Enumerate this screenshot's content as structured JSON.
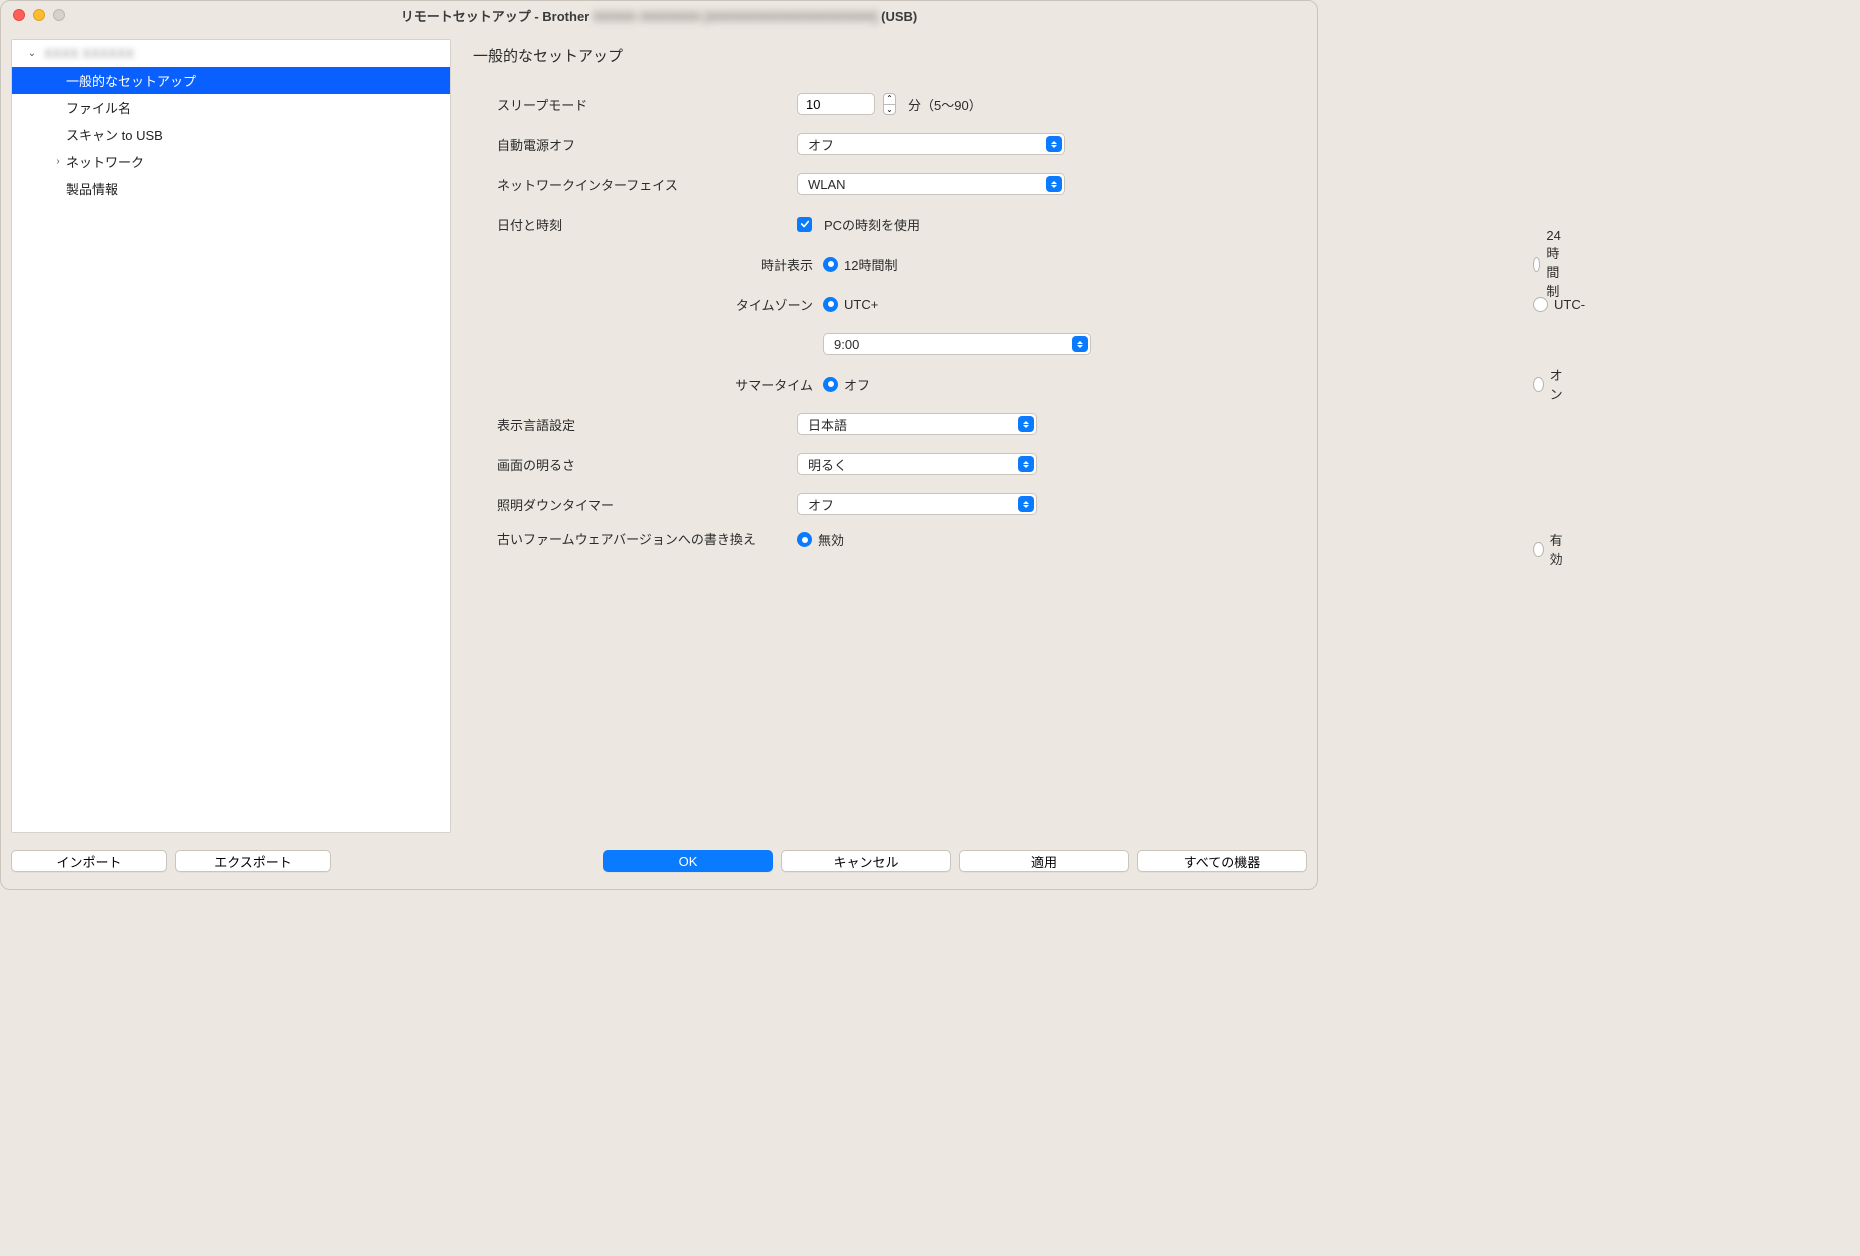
{
  "window": {
    "title_prefix": "リモートセットアップ - Brother ",
    "title_redacted": "XXXXX XXXXXXX [XXXXXXXXXXXXXXXXXXX]",
    "title_suffix": "  (USB)"
  },
  "sidebar": {
    "root_redacted": "XXXX XXXXXX",
    "items": {
      "general": "一般的なセットアップ",
      "filename": "ファイル名",
      "scan_usb": "スキャン to USB",
      "network": "ネットワーク",
      "product_info": "製品情報"
    }
  },
  "section_title": "一般的なセットアップ",
  "labels": {
    "sleep_mode": "スリープモード",
    "sleep_unit": "分（5〜90）",
    "auto_power_off": "自動電源オフ",
    "network_if": "ネットワークインターフェイス",
    "date_time": "日付と時刻",
    "use_pc_time": "PCの時刻を使用",
    "clock_display": "時計表示",
    "clock_12h": "12時間制",
    "clock_24h": "24時間制",
    "timezone": "タイムゾーン",
    "utc_plus": "UTC+",
    "utc_minus": "UTC-",
    "summer_time": "サマータイム",
    "st_off": "オフ",
    "st_on": "オン",
    "display_lang": "表示言語設定",
    "brightness": "画面の明るさ",
    "dim_timer": "照明ダウンタイマー",
    "firmware_downgrade": "古いファームウェアバージョンへの書き換え",
    "fw_disabled": "無効",
    "fw_enabled": "有効"
  },
  "values": {
    "sleep_minutes": "10",
    "auto_power_off": "オフ",
    "network_if": "WLAN",
    "tz_offset": "9:00",
    "display_lang": "日本語",
    "brightness": "明るく",
    "dim_timer": "オフ"
  },
  "footer": {
    "import": "インポート",
    "export": "エクスポート",
    "ok": "OK",
    "cancel": "キャンセル",
    "apply": "適用",
    "all_devices": "すべての機器"
  }
}
